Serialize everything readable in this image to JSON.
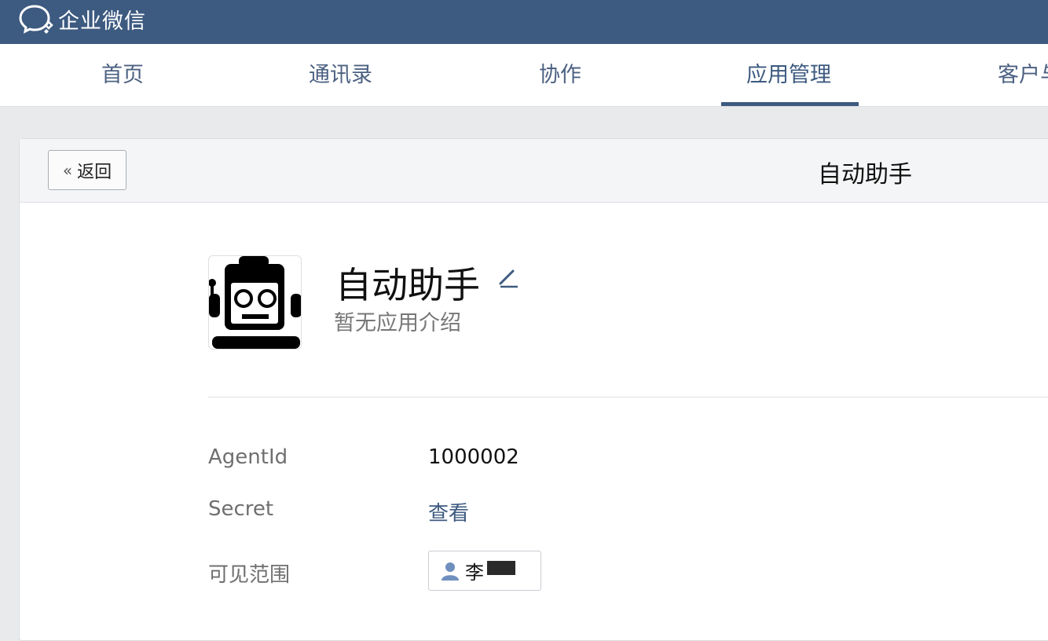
{
  "brand": {
    "name": "企业微信",
    "icon": "wecom-chat-icon"
  },
  "nav": {
    "tabs": [
      {
        "label": "首页",
        "active": false
      },
      {
        "label": "通讯录",
        "active": false
      },
      {
        "label": "协作",
        "active": false
      },
      {
        "label": "应用管理",
        "active": true
      },
      {
        "label": "客户与",
        "active": false
      }
    ]
  },
  "header": {
    "back_label": "返回",
    "back_icon": "double-chevron-left-icon",
    "title": "自动助手"
  },
  "app": {
    "name": "自动助手",
    "description": "暂无应用介绍",
    "logo_icon": "robot-icon",
    "edit_icon": "pencil-edit-icon"
  },
  "details": {
    "agentid_label": "AgentId",
    "agentid_value": "1000002",
    "secret_label": "Secret",
    "secret_link": "查看",
    "scope_label": "可见范围",
    "scope_member": "李"
  },
  "colors": {
    "brand": "#3d5a80",
    "link": "#3d5a80"
  }
}
